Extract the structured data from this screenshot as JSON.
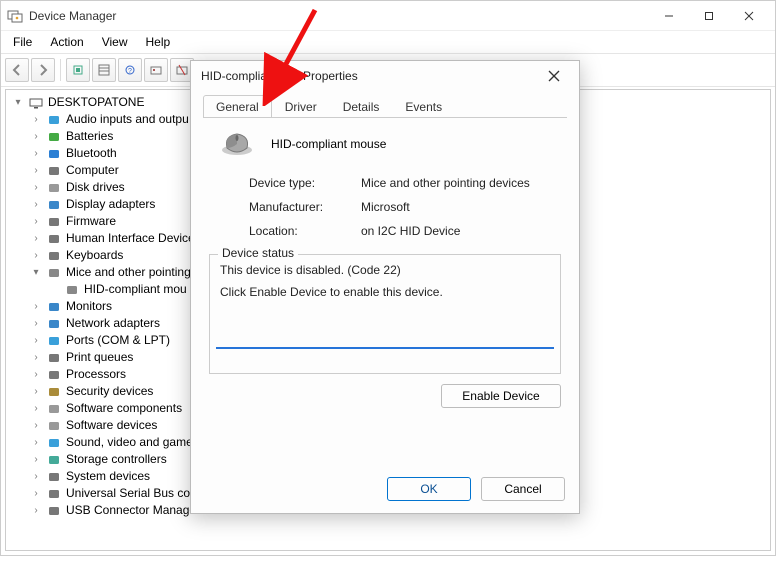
{
  "window": {
    "title": "Device Manager",
    "menu": {
      "file": "File",
      "action": "Action",
      "view": "View",
      "help": "Help"
    }
  },
  "toolbar_icons": [
    "back",
    "forward",
    "|",
    "show-hidden",
    "properties-page",
    "help-icon2",
    "refresh",
    "stop"
  ],
  "tree": {
    "root": "DESKTOPATONE",
    "items": [
      {
        "label": "Audio inputs and outpu",
        "icon": "audio"
      },
      {
        "label": "Batteries",
        "icon": "battery"
      },
      {
        "label": "Bluetooth",
        "icon": "bluetooth"
      },
      {
        "label": "Computer",
        "icon": "computer"
      },
      {
        "label": "Disk drives",
        "icon": "disk"
      },
      {
        "label": "Display adapters",
        "icon": "display"
      },
      {
        "label": "Firmware",
        "icon": "firmware"
      },
      {
        "label": "Human Interface Device",
        "icon": "hid"
      },
      {
        "label": "Keyboards",
        "icon": "keyboard"
      },
      {
        "label": "Mice and other pointing",
        "icon": "mouse",
        "expanded": true,
        "child": {
          "label": "HID-compliant mou",
          "icon": "mouse"
        }
      },
      {
        "label": "Monitors",
        "icon": "monitor"
      },
      {
        "label": "Network adapters",
        "icon": "netadapter"
      },
      {
        "label": "Ports (COM & LPT)",
        "icon": "port"
      },
      {
        "label": "Print queues",
        "icon": "printer"
      },
      {
        "label": "Processors",
        "icon": "cpu"
      },
      {
        "label": "Security devices",
        "icon": "security"
      },
      {
        "label": "Software components",
        "icon": "swcomp"
      },
      {
        "label": "Software devices",
        "icon": "swdev"
      },
      {
        "label": "Sound, video and game",
        "icon": "sound"
      },
      {
        "label": "Storage controllers",
        "icon": "storage"
      },
      {
        "label": "System devices",
        "icon": "system"
      },
      {
        "label": "Universal Serial Bus cont",
        "icon": "usb"
      },
      {
        "label": "USB Connector Managers",
        "icon": "usbconn"
      }
    ]
  },
  "dialog": {
    "title": "HID-compliant      use Properties",
    "tabs": {
      "general": "General",
      "driver": "Driver",
      "details": "Details",
      "events": "Events"
    },
    "device_name": "HID-compliant mouse",
    "info": {
      "type_label": "Device type:",
      "type": "Mice and other pointing devices",
      "manufacturer_label": "Manufacturer:",
      "manufacturer": "Microsoft",
      "location_label": "Location:",
      "location": "on I2C HID Device"
    },
    "status": {
      "legend": "Device status",
      "line1": "This device is disabled. (Code 22)",
      "line2": "Click Enable Device to enable this device."
    },
    "buttons": {
      "enable": "Enable Device",
      "ok": "OK",
      "cancel": "Cancel"
    }
  }
}
